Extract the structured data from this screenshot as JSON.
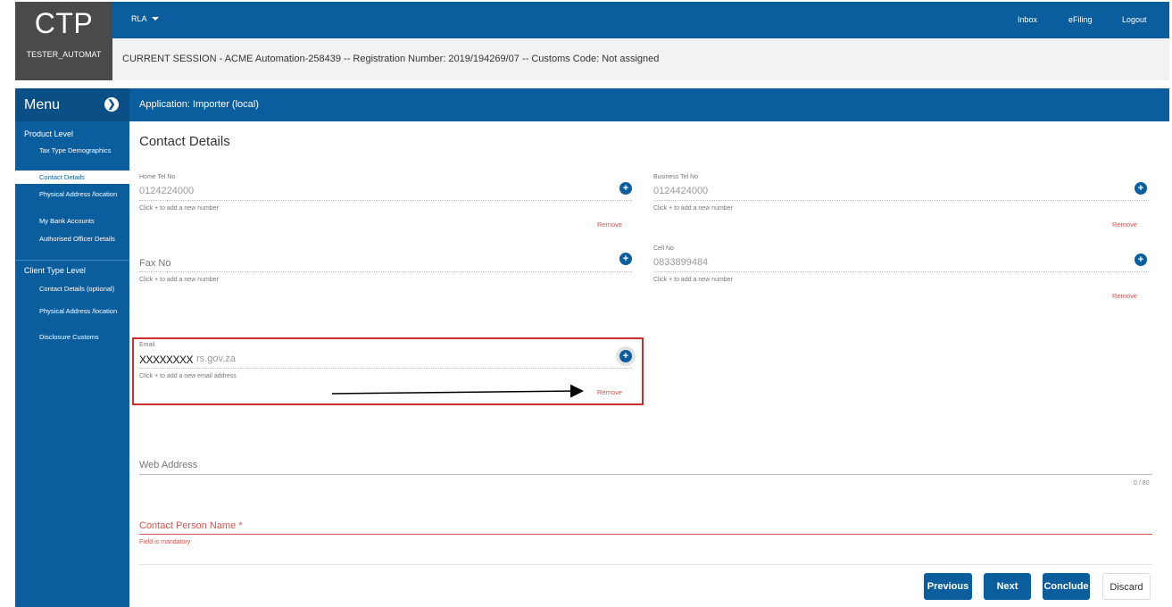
{
  "header": {
    "logo": "CTP",
    "username": "TESTER_AUTOMAT",
    "rla_label": "RLA",
    "links": {
      "inbox": "Inbox",
      "efiling": "eFiling",
      "logout": "Logout"
    },
    "session": "CURRENT SESSION - ACME Automation-258439 -- Registration Number: 2019/194269/07 -- Customs Code: Not assigned"
  },
  "sidebar": {
    "title": "Menu",
    "toggle_icon": "arrow-circle-icon",
    "product_level": {
      "heading": "Product Level",
      "items": [
        "Tax Type Demographics",
        "Contact Details",
        "Physical Address /location",
        "My Bank Accounts",
        "Authorised Officer Details"
      ],
      "active": "Contact Details"
    },
    "client_type_level": {
      "heading": "Client Type Level",
      "items": [
        "Contact Details (optional)",
        "Physical Address /location",
        "Disclosure Customs"
      ]
    }
  },
  "app": {
    "title": "Application: Importer (local)"
  },
  "page": {
    "title": "Contact Details",
    "home_tel": {
      "label": "Home Tel No",
      "value": "0124224000",
      "hint": "Click + to add a new number",
      "remove": "Remove"
    },
    "business_tel": {
      "label": "Business Tel No",
      "value": "0124424000",
      "hint": "Click + to add a new number",
      "remove": "Remove"
    },
    "fax": {
      "placeholder": "Fax No",
      "hint": "Click + to add a new number"
    },
    "cell": {
      "label": "Cell No",
      "value": "0833899484",
      "hint": "Click + to add a new number",
      "remove": "Remove"
    },
    "email": {
      "label": "Email",
      "masked": "XXXXXXXX",
      "value_suffix": "rs.gov.za",
      "hint": "Click + to add a new email address",
      "remove": "Remove"
    },
    "web_address": {
      "placeholder": "Web Address",
      "counter": "0 / 80"
    },
    "contact_person": {
      "placeholder": "Contact Person Name *",
      "error": "Field is mandatory"
    }
  },
  "buttons": {
    "previous": "Previous",
    "next": "Next",
    "conclude": "Conclude",
    "discard": "Discard"
  },
  "colors": {
    "primary": "#0b5e9e",
    "error": "#d9534f",
    "highlight": "#c9302c"
  }
}
